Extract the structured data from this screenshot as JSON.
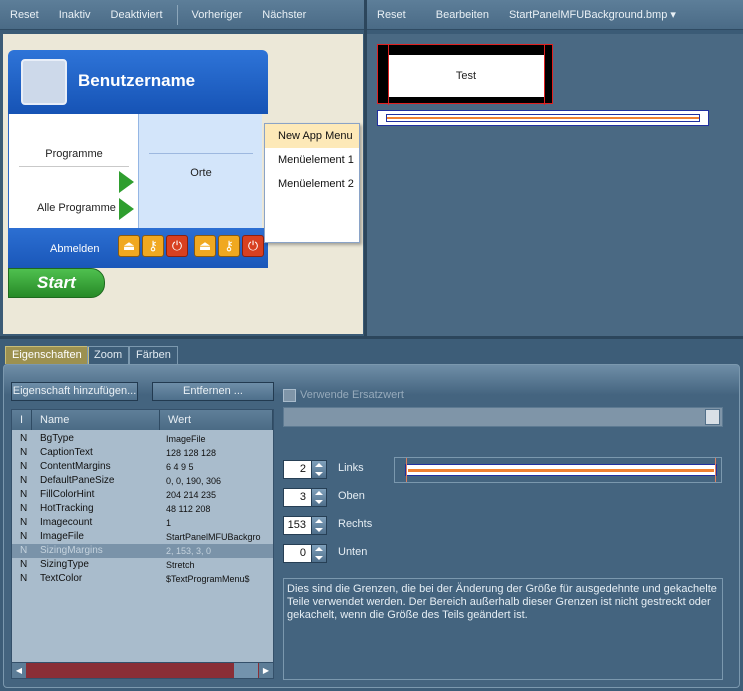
{
  "left_toolbar": {
    "reset": "Reset",
    "inactive": "Inaktiv",
    "disabled": "Deaktiviert",
    "previous": "Vorheriger",
    "next": "Nächster"
  },
  "right_toolbar": {
    "reset": "Reset",
    "edit": "Bearbeiten",
    "file": "StartPanelMFUBackground.bmp"
  },
  "start_menu": {
    "username": "Benutzername",
    "programs": "Programme",
    "all_programs": "Alle Programme",
    "places": "Orte",
    "logoff": "Abmelden",
    "start": "Start"
  },
  "popup_menu": {
    "items": [
      "New App Menu",
      "Menüelement 1",
      "Menüelement 2"
    ]
  },
  "preview": {
    "text": "Test"
  },
  "tabs": [
    "Eigenschaften",
    "Zoom",
    "Färben"
  ],
  "buttons": {
    "add_property": "Eigenschaft hinzufügen...",
    "remove": "Entfernen ..."
  },
  "checkbox": {
    "label": "Verwende Ersatzwert"
  },
  "grid": {
    "columns": [
      "I",
      "Name",
      "Wert"
    ],
    "rows": [
      {
        "i": "N",
        "name": "BgType",
        "value": "ImageFile"
      },
      {
        "i": "N",
        "name": "CaptionText",
        "value": "128 128 128"
      },
      {
        "i": "N",
        "name": "ContentMargins",
        "value": "6 4 9 5"
      },
      {
        "i": "N",
        "name": "DefaultPaneSize",
        "value": "0, 0, 190, 306"
      },
      {
        "i": "N",
        "name": "FillColorHint",
        "value": "204 214 235"
      },
      {
        "i": "N",
        "name": "HotTracking",
        "value": "48 112 208"
      },
      {
        "i": "N",
        "name": "Imagecount",
        "value": "1"
      },
      {
        "i": "N",
        "name": "ImageFile",
        "value": "StartPanelMFUBackgro"
      },
      {
        "i": "N",
        "name": "SizingMargins",
        "value": "2, 153, 3, 0"
      },
      {
        "i": "N",
        "name": "SizingType",
        "value": "Stretch"
      },
      {
        "i": "N",
        "name": "TextColor",
        "value": "$TextProgramMenu$"
      }
    ]
  },
  "margins": {
    "left": {
      "value": "2",
      "label": "Links"
    },
    "top": {
      "value": "3",
      "label": "Oben"
    },
    "right": {
      "value": "153",
      "label": "Rechts"
    },
    "bottom": {
      "value": "0",
      "label": "Unten"
    }
  },
  "description": "Dies sind die Grenzen, die bei der Änderung der Größe für ausgedehnte und gekachelte Teile verwendet werden. Der Bereich außerhalb dieser Grenzen ist nicht gestreckt oder gekachelt, wenn die Größe des Teils geändert ist.",
  "colors": {
    "accent": "#9c9150",
    "panel": "#3b5b76",
    "startblue": "#1f63c7",
    "startgreen": "#2f9e2f"
  }
}
